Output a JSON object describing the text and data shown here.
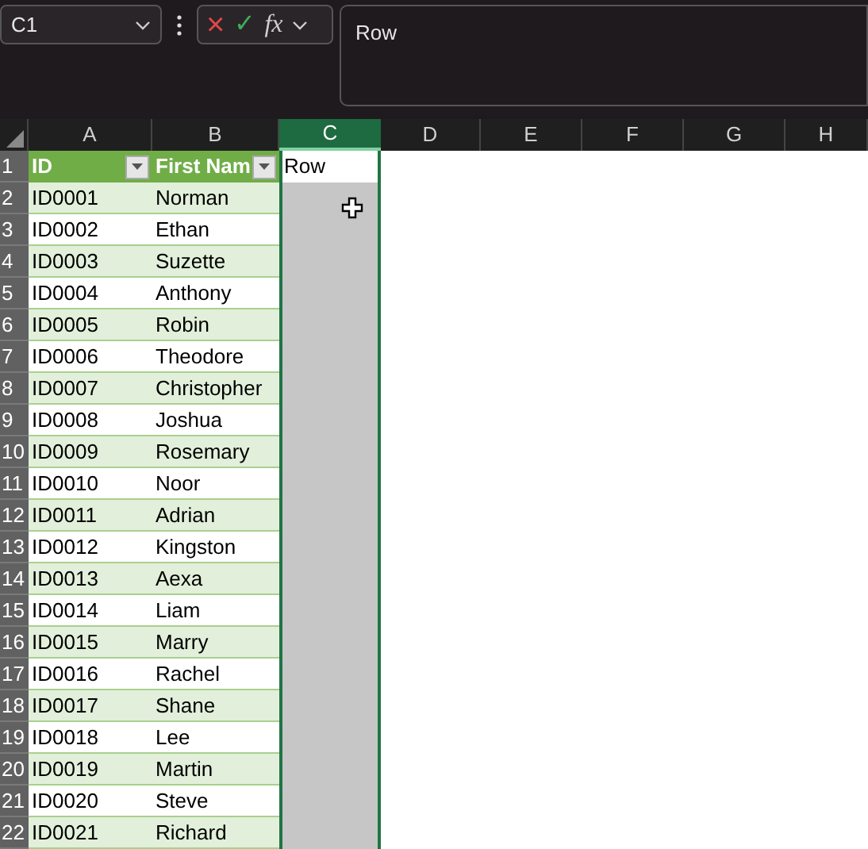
{
  "name_box": {
    "value": "C1"
  },
  "formula_bar": {
    "cancel": "×",
    "enter": "✓",
    "function_label": "fx",
    "value": "Row"
  },
  "columns": [
    {
      "label": "A",
      "selected": false
    },
    {
      "label": "B",
      "selected": false
    },
    {
      "label": "C",
      "selected": true
    },
    {
      "label": "D",
      "selected": false
    },
    {
      "label": "E",
      "selected": false
    },
    {
      "label": "F",
      "selected": false
    },
    {
      "label": "G",
      "selected": false
    },
    {
      "label": "H",
      "selected": false
    }
  ],
  "table_headers": [
    {
      "label": "ID",
      "filter": true
    },
    {
      "label": "First Nam",
      "filter": true
    }
  ],
  "active_cell": {
    "value": "Row"
  },
  "rows": [
    {
      "number": "1"
    },
    {
      "number": "2",
      "cells": [
        "ID0001",
        "Norman"
      ]
    },
    {
      "number": "3",
      "cells": [
        "ID0002",
        "Ethan"
      ]
    },
    {
      "number": "4",
      "cells": [
        "ID0003",
        "Suzette"
      ]
    },
    {
      "number": "5",
      "cells": [
        "ID0004",
        "Anthony"
      ]
    },
    {
      "number": "6",
      "cells": [
        "ID0005",
        "Robin"
      ]
    },
    {
      "number": "7",
      "cells": [
        "ID0006",
        "Theodore"
      ]
    },
    {
      "number": "8",
      "cells": [
        "ID0007",
        "Christopher"
      ]
    },
    {
      "number": "9",
      "cells": [
        "ID0008",
        "Joshua"
      ]
    },
    {
      "number": "10",
      "cells": [
        "ID0009",
        "Rosemary"
      ]
    },
    {
      "number": "11",
      "cells": [
        "ID0010",
        "Noor"
      ]
    },
    {
      "number": "12",
      "cells": [
        "ID0011",
        "Adrian"
      ]
    },
    {
      "number": "13",
      "cells": [
        "ID0012",
        "Kingston"
      ]
    },
    {
      "number": "14",
      "cells": [
        "ID0013",
        "Aexa"
      ]
    },
    {
      "number": "15",
      "cells": [
        "ID0014",
        "Liam"
      ]
    },
    {
      "number": "16",
      "cells": [
        "ID0015",
        "Marry"
      ]
    },
    {
      "number": "17",
      "cells": [
        "ID0016",
        "Rachel"
      ]
    },
    {
      "number": "18",
      "cells": [
        "ID0017",
        "Shane"
      ]
    },
    {
      "number": "19",
      "cells": [
        "ID0018",
        "Lee"
      ]
    },
    {
      "number": "20",
      "cells": [
        "ID0019",
        "Martin"
      ]
    },
    {
      "number": "21",
      "cells": [
        "ID0020",
        "Steve"
      ]
    },
    {
      "number": "22",
      "cells": [
        "ID0021",
        "Richard"
      ]
    }
  ]
}
